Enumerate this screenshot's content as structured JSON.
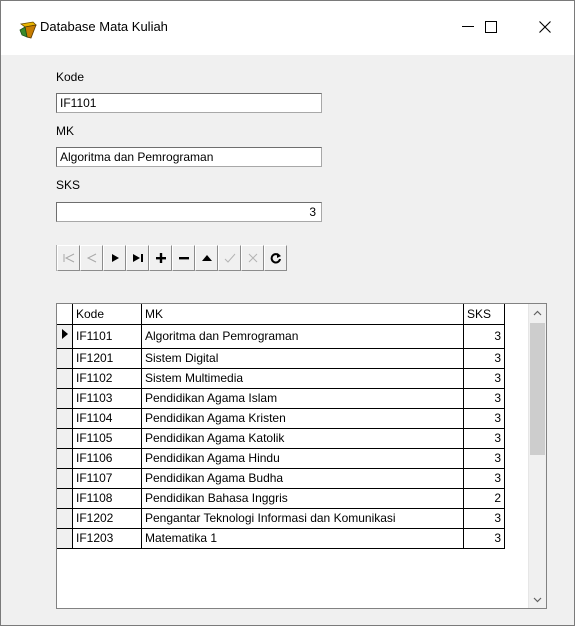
{
  "window": {
    "title": "Database Mata Kuliah",
    "minimize_symbol": "—",
    "close_symbol": "✕"
  },
  "form": {
    "kode_label": "Kode",
    "kode_value": "IF1101",
    "mk_label": "MK",
    "mk_value": "Algoritma dan Pemrograman",
    "sks_label": "SKS",
    "sks_value": "3"
  },
  "navigator": {
    "buttons": [
      "first",
      "prior",
      "next",
      "last",
      "insert",
      "delete",
      "edit",
      "post",
      "cancel",
      "refresh"
    ],
    "enabled": [
      false,
      false,
      true,
      true,
      true,
      true,
      true,
      false,
      false,
      true
    ]
  },
  "grid": {
    "columns": [
      "Kode",
      "MK",
      "SKS"
    ],
    "rows": [
      [
        "IF1101",
        "Algoritma dan Pemrograman",
        "3"
      ],
      [
        "IF1201",
        "Sistem Digital",
        "3"
      ],
      [
        "IF1102",
        "Sistem Multimedia",
        "3"
      ],
      [
        "IF1103",
        "Pendidikan Agama Islam",
        "3"
      ],
      [
        "IF1104",
        "Pendidikan Agama Kristen",
        "3"
      ],
      [
        "IF1105",
        "Pendidikan Agama Katolik",
        "3"
      ],
      [
        "IF1106",
        "Pendidikan Agama Hindu",
        "3"
      ],
      [
        "IF1107",
        "Pendidikan Agama Budha",
        "3"
      ],
      [
        "IF1108",
        "Pendidikan Bahasa Inggris",
        "2"
      ],
      [
        "IF1202",
        "Pengantar Teknologi Informasi dan Komunikasi",
        "3"
      ],
      [
        "IF1203",
        "Matematika 1",
        "3"
      ]
    ],
    "selected_row": 0
  }
}
